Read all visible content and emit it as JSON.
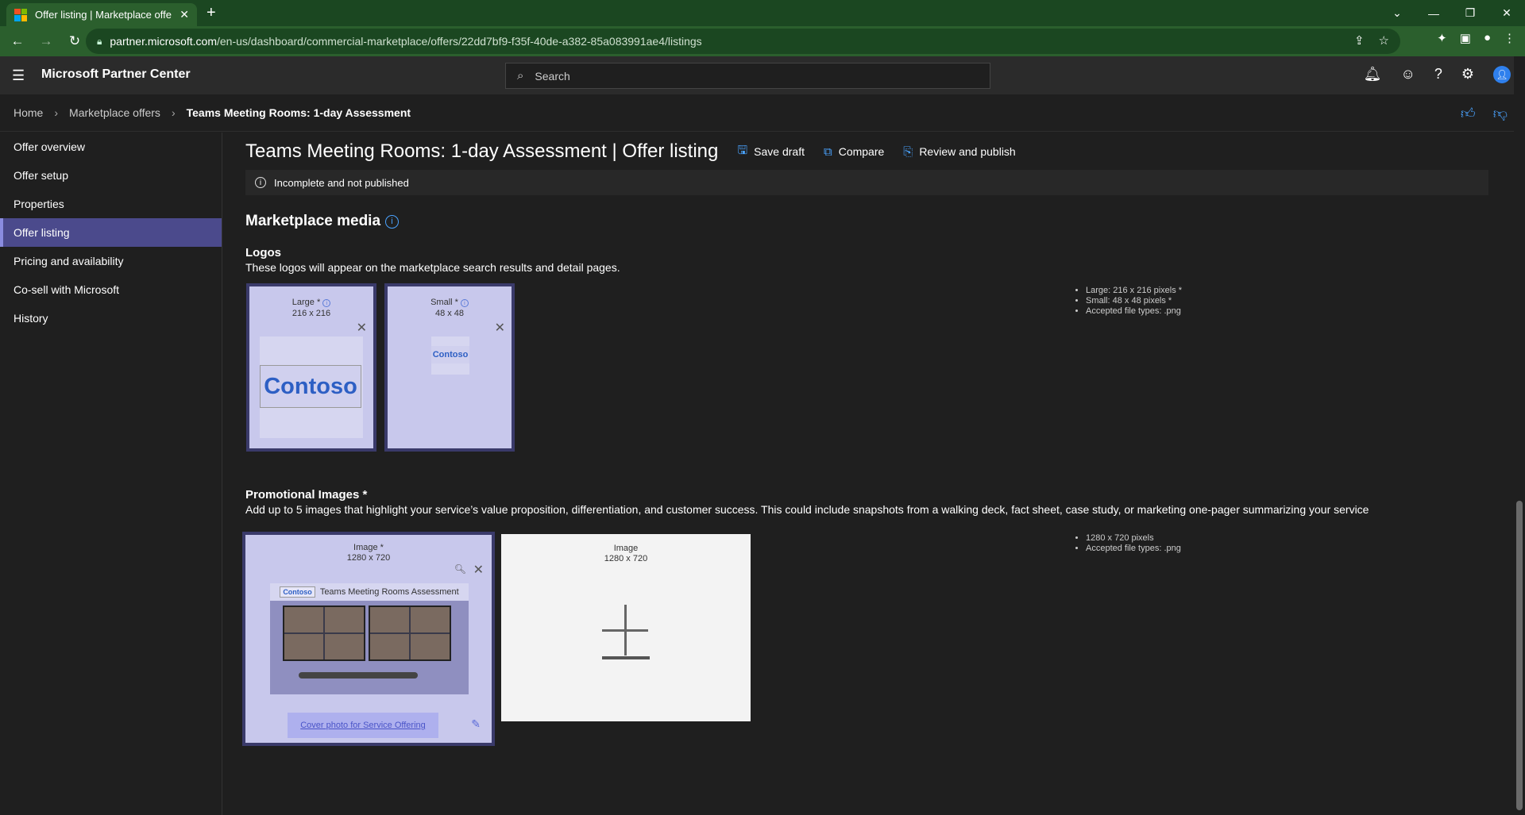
{
  "browser": {
    "tab_title": "Offer listing | Marketplace offers",
    "url_host": "partner.microsoft.com",
    "url_path": "/en-us/dashboard/commercial-marketplace/offers/22dd7bf9-f35f-40de-a382-85a083991ae4/listings"
  },
  "header": {
    "app_title": "Microsoft Partner Center",
    "search_placeholder": "Search"
  },
  "breadcrumb": {
    "home": "Home",
    "offers": "Marketplace offers",
    "current": "Teams Meeting Rooms: 1-day Assessment"
  },
  "sidebar": {
    "items": [
      {
        "label": "Offer overview"
      },
      {
        "label": "Offer setup"
      },
      {
        "label": "Properties"
      },
      {
        "label": "Offer listing",
        "active": true
      },
      {
        "label": "Pricing and availability"
      },
      {
        "label": "Co-sell with Microsoft"
      },
      {
        "label": "History"
      }
    ]
  },
  "page": {
    "title": "Teams Meeting Rooms: 1-day Assessment",
    "title_suffix": " | Offer listing",
    "save_draft": "Save draft",
    "compare": "Compare",
    "review_publish": "Review and publish",
    "status": "Incomplete and not published"
  },
  "media": {
    "section_title": "Marketplace media",
    "logos_title": "Logos",
    "logos_desc": "These logos will appear on the marketplace search results and detail pages.",
    "large_label": "Large *",
    "large_size": "216 x 216",
    "small_label": "Small *",
    "small_size": "48 x 48",
    "logo_text": "ontoso",
    "logo_req": [
      "Large: 216 x 216 pixels *",
      "Small: 48 x 48 pixels *",
      "Accepted file types: .png"
    ],
    "promo_title": "Promotional Images *",
    "promo_desc": "Add up to 5 images that highlight your service’s value proposition, differentiation, and customer success. This could include snapshots from a walking deck, fact sheet, case study, or marketing one-pager summarizing your service",
    "image_label": "Image *",
    "image_size": "1280 x 720",
    "empty_label": "Image",
    "empty_size": "1280 x 720",
    "promo_banner": "Teams Meeting Rooms Assessment",
    "promo_logo": "Contoso",
    "caption": "Cover photo for Service Offering",
    "promo_req": [
      "1280 x 720 pixels",
      "Accepted file types: .png"
    ]
  },
  "colors": {
    "accent": "#4aa3ff",
    "active_nav": "#4b4a8c",
    "tab_green": "#2b5f2d"
  }
}
